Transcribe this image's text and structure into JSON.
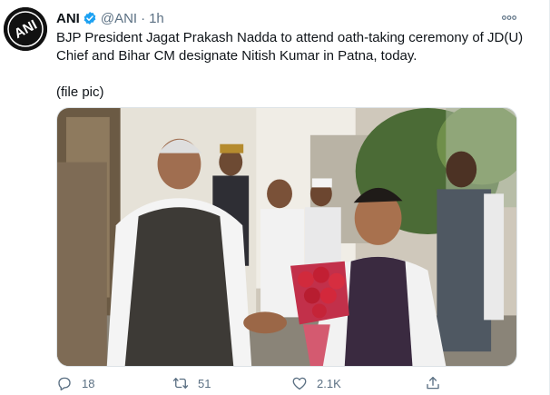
{
  "author": {
    "name": "ANI",
    "handle": "@ANI",
    "separator": "·",
    "time": "1h",
    "avatar_text": "ANI"
  },
  "tweet": {
    "text": "BJP President Jagat Prakash Nadda to attend oath-taking ceremony of JD(U) Chief and Bihar CM designate Nitish Kumar in Patna, today.",
    "note": "(file pic)"
  },
  "media": {
    "alt": "Two men shaking hands, one holding a bouquet of red roses, with several men standing behind them outside a building"
  },
  "actions": {
    "replies": "18",
    "retweets": "51",
    "likes": "2.1K"
  },
  "colors": {
    "text": "#0f1419",
    "muted": "#5b7083",
    "verified": "#1da1f2"
  },
  "icons": {
    "more": "more-horizontal-icon",
    "verified": "verified-badge-icon",
    "reply": "reply-icon",
    "retweet": "retweet-icon",
    "like": "heart-icon",
    "share": "share-icon"
  }
}
